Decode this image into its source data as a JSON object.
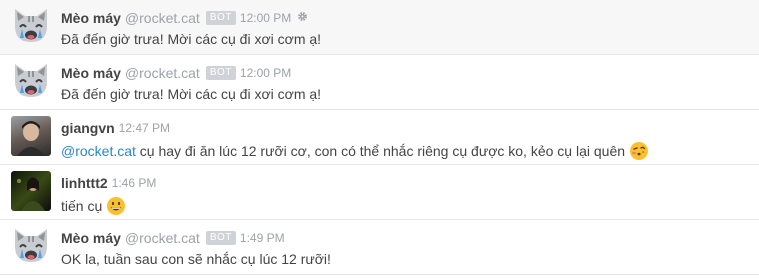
{
  "messages": [
    {
      "name": "Mèo máy",
      "handle": "@rocket.cat",
      "badge": "BOT",
      "time": "12:00 PM",
      "text": "Đã đến giờ trưa! Mời các cụ đi xơi cơm ạ!",
      "avatar_icon": "cat-icon",
      "settings_icon": "gear-icon"
    },
    {
      "name": "Mèo máy",
      "handle": "@rocket.cat",
      "badge": "BOT",
      "time": "12:00 PM",
      "text": "Đã đến giờ trưa! Mời các cụ đi xơi cơm ạ!",
      "avatar_icon": "cat-icon"
    },
    {
      "name": "giangvn",
      "time": "12:47 PM",
      "mention": "@rocket.cat",
      "text": " cụ hay đi ăn lúc 12 rưỡi cơ, con có thể nhắc riêng cụ được ko, kẻo cụ lại quên",
      "emoji": "kissing-face-emoji"
    },
    {
      "name": "linhttt2",
      "time": "1:46 PM",
      "text": "tiến cụ",
      "emoji": "grinning-face-emoji"
    },
    {
      "name": "Mèo máy",
      "handle": "@rocket.cat",
      "badge": "BOT",
      "time": "1:49 PM",
      "text": "OK la, tuần sau con sẽ nhắc cụ lúc 12 rưỡi!",
      "avatar_icon": "cat-icon"
    }
  ],
  "colors": {
    "mention": "#2a86c9",
    "meta_text": "#9ea2a8",
    "bot_badge": "#cfd2d6",
    "highlight_row": "#f7f7f7"
  }
}
